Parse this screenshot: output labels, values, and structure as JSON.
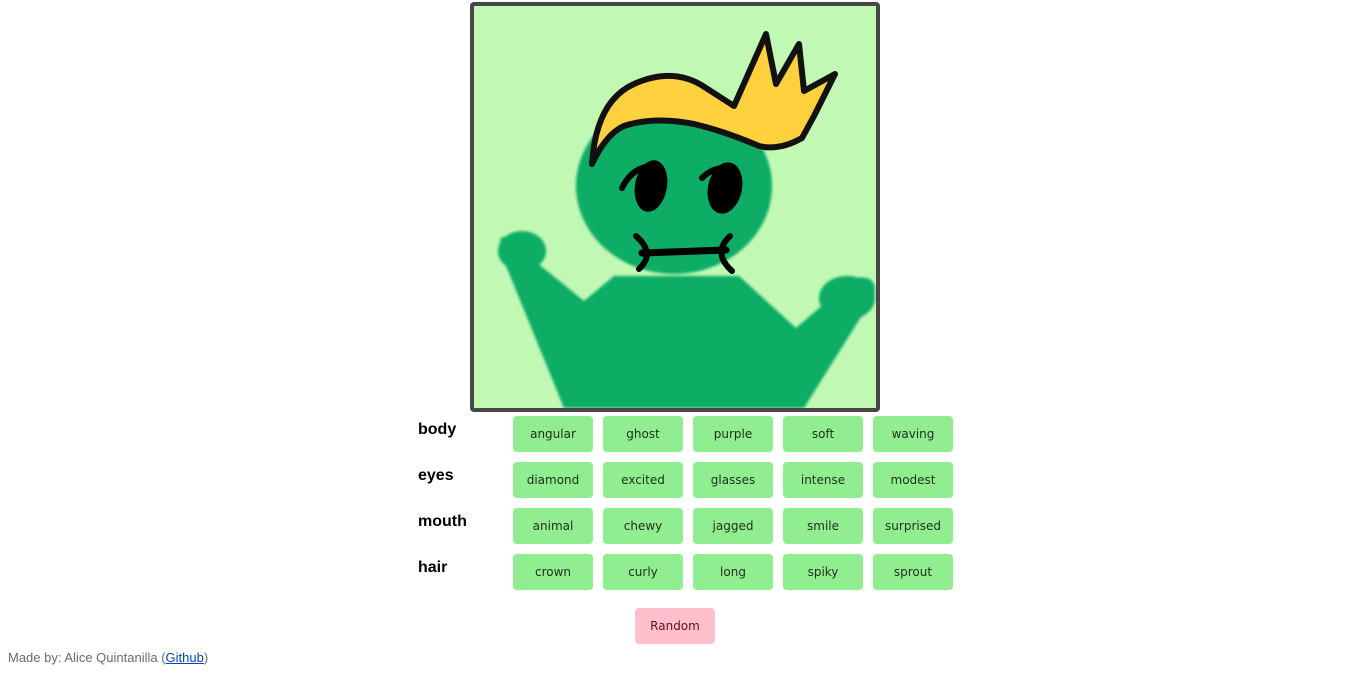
{
  "colors": {
    "background_canvas": "#c0f8b4",
    "body": "#10ad66",
    "hair": "#ffd13f",
    "frame": "#474747",
    "option_button": "#90ee90",
    "random_button": "#ffc0cb",
    "link": "#0645ad"
  },
  "avatar": {
    "body": "waving",
    "eyes": "intense",
    "mouth": "chewy",
    "hair": "crown"
  },
  "categories": [
    {
      "label": "body",
      "options": [
        "angular",
        "ghost",
        "purple",
        "soft",
        "waving"
      ]
    },
    {
      "label": "eyes",
      "options": [
        "diamond",
        "excited",
        "glasses",
        "intense",
        "modest"
      ]
    },
    {
      "label": "mouth",
      "options": [
        "animal",
        "chewy",
        "jagged",
        "smile",
        "surprised"
      ]
    },
    {
      "label": "hair",
      "options": [
        "crown",
        "curly",
        "long",
        "spiky",
        "sprout"
      ]
    }
  ],
  "random_label": "Random",
  "footer": {
    "prefix": "Made by: Alice Quintanilla (",
    "link_text": "Github",
    "suffix": ")"
  }
}
